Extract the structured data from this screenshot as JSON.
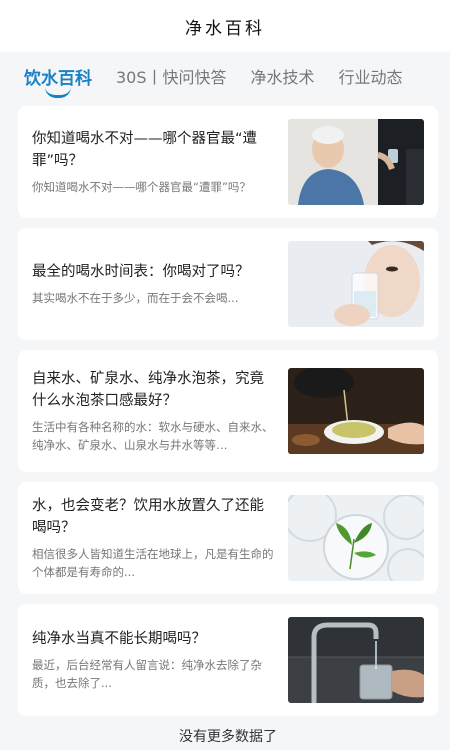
{
  "header": {
    "title": "净水百科"
  },
  "tabs": [
    {
      "label": "饮水百科",
      "active": true
    },
    {
      "label": "30S丨快问快答",
      "active": false
    },
    {
      "label": "净水技术",
      "active": false
    },
    {
      "label": "行业动态",
      "active": false
    }
  ],
  "articles": [
    {
      "headline": "你知道喝水不对——哪个器官最“遭罪”吗？",
      "summary": "你知道喝水不对——哪个器官最“遭罪”吗？",
      "image": "elderly-man-drinking-photo"
    },
    {
      "headline": "最全的喝水时间表：你喝对了吗？",
      "summary": "其实喝水不在于多少，而在于会不会喝...",
      "image": "woman-drinking-water-photo"
    },
    {
      "headline": "自来水、矿泉水、纯净水泡茶，究竟什么水泡茶口感最好？",
      "summary": "生活中有各种名称的水：软水与硬水、自来水、纯净水、矿泉水、山泉水与井水等等…",
      "image": "tea-pouring-photo"
    },
    {
      "headline": "水，也会变老？饮用水放置久了还能喝吗？",
      "summary": "相信很多人皆知道生活在地球上，凡是有生命的个体都是有寿命的...",
      "image": "petri-dish-leaf-photo"
    },
    {
      "headline": "纯净水当真不能长期喝吗？",
      "summary": "最近，后台经常有人留言说：纯净水去除了杂质，也去除了...",
      "image": "faucet-glass-photo"
    }
  ],
  "footer": {
    "text": "没有更多数据了"
  },
  "colors": {
    "accent": "#1a82c4"
  }
}
